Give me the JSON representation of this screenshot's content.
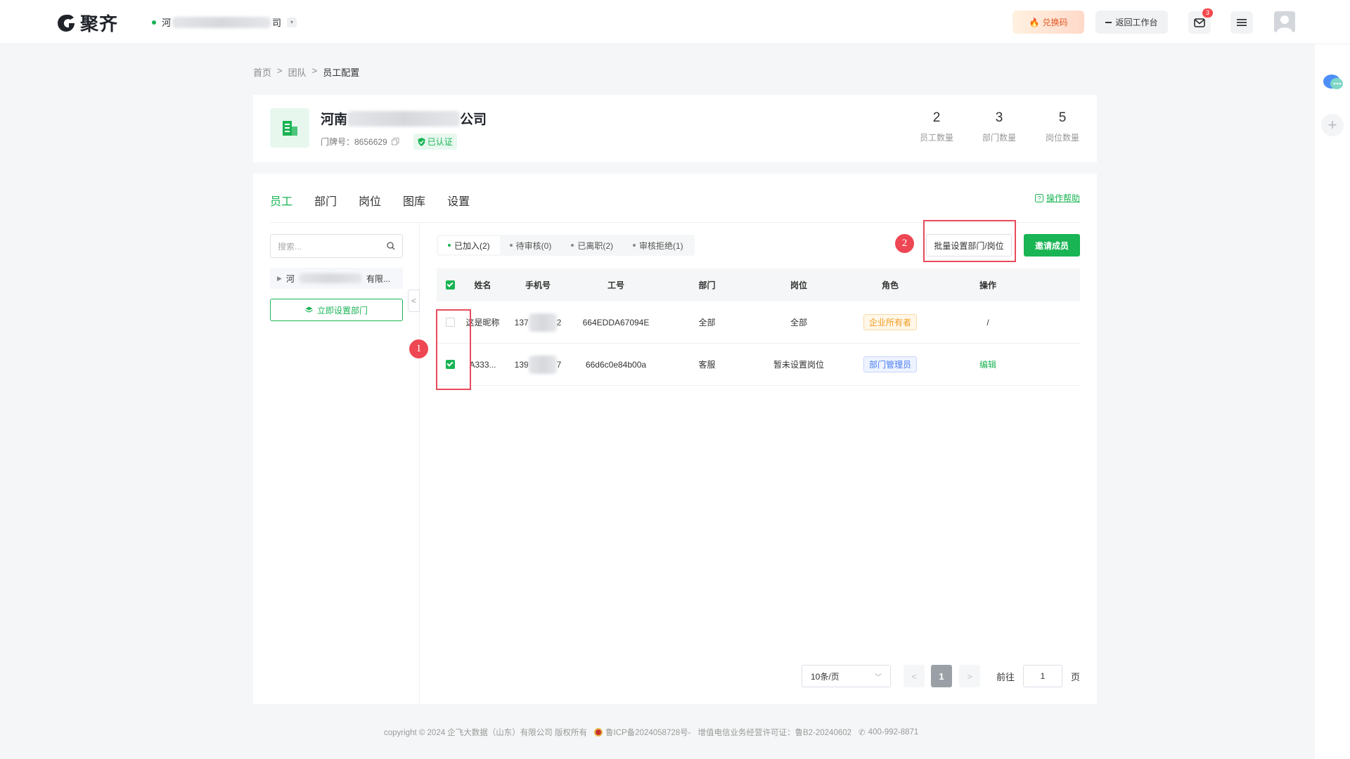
{
  "app": {
    "name": "聚齐"
  },
  "org_switch": {
    "prefix": "河",
    "suffix": "司"
  },
  "header": {
    "redeem_label": "兑换码",
    "back_label": "返回工作台",
    "mail_badge": "3"
  },
  "breadcrumb": {
    "items": [
      "首页",
      "团队",
      "员工配置"
    ]
  },
  "company": {
    "name_prefix": "河南",
    "name_suffix": "公司",
    "door_label": "门牌号：8656629",
    "verified_label": "已认证",
    "stats": [
      {
        "num": "2",
        "label": "员工数量"
      },
      {
        "num": "3",
        "label": "部门数量"
      },
      {
        "num": "5",
        "label": "岗位数量"
      }
    ]
  },
  "tabs": [
    "员工",
    "部门",
    "岗位",
    "图库",
    "设置"
  ],
  "help_label": "操作帮助",
  "sidebar": {
    "search_placeholder": "搜索...",
    "tree_prefix": "河",
    "tree_suffix": "有限...",
    "set_dept_label": "立即设置部门"
  },
  "status_tabs": [
    "已加入(2)",
    "待审核(0)",
    "已离职(2)",
    "审核拒绝(1)"
  ],
  "batch_label": "批量设置部门/岗位",
  "invite_label": "邀请成员",
  "annotations": {
    "one": "1",
    "two": "2"
  },
  "table": {
    "headers": [
      "姓名",
      "手机号",
      "工号",
      "部门",
      "岗位",
      "角色",
      "操作"
    ],
    "rows": [
      {
        "name": "这是昵称",
        "phone_start": "137",
        "phone_end": "2",
        "id": "664EDDA67094E",
        "dept": "全部",
        "post": "全部",
        "role": "企业所有者",
        "action": "/"
      },
      {
        "name": "A333...",
        "phone_start": "139",
        "phone_end": "7",
        "id": "66d6c0e84b00a",
        "dept": "客服",
        "post": "暂未设置岗位",
        "role": "部门管理员",
        "action": "编辑"
      }
    ]
  },
  "pagination": {
    "size_label": "10条/页",
    "current": "1",
    "goto_label": "前往",
    "goto_value": "1",
    "page_label": "页"
  },
  "footer": {
    "copyright": "copyright © 2024 企飞大数据（山东）有限公司 版权所有",
    "icp": "鲁ICP备2024058728号-",
    "license": "增值电信业务经营许可证：鲁B2-20240602",
    "phone": "400-992-8871"
  },
  "colors": {
    "brand_green": "#19b454",
    "annotation_red": "#e84b5b"
  }
}
